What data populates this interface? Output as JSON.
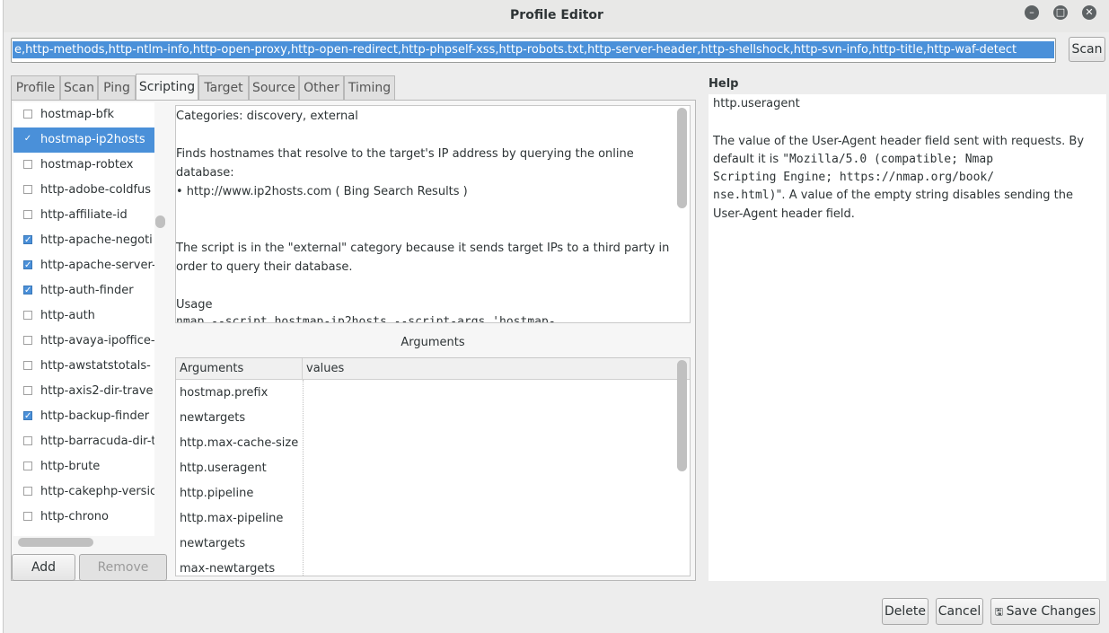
{
  "window": {
    "title": "Profile Editor"
  },
  "command": {
    "value": "e,http-methods,http-ntlm-info,http-open-proxy,http-open-redirect,http-phpself-xss,http-robots.txt,http-server-header,http-shellshock,http-svn-info,http-title,http-waf-detect"
  },
  "buttons": {
    "scan": "Scan",
    "add": "Add",
    "remove": "Remove",
    "delete": "Delete",
    "cancel": "Cancel",
    "save": "Save Changes"
  },
  "tabs": [
    "Profile",
    "Scan",
    "Ping",
    "Scripting",
    "Target",
    "Source",
    "Other",
    "Timing"
  ],
  "active_tab": "Scripting",
  "scripts": [
    {
      "label": "hostmap-bfk",
      "checked": false,
      "selected": false
    },
    {
      "label": "hostmap-ip2hosts",
      "checked": true,
      "selected": true
    },
    {
      "label": "hostmap-robtex",
      "checked": false,
      "selected": false
    },
    {
      "label": "http-adobe-coldfus",
      "checked": false,
      "selected": false
    },
    {
      "label": "http-affiliate-id",
      "checked": false,
      "selected": false
    },
    {
      "label": "http-apache-negoti",
      "checked": true,
      "selected": false
    },
    {
      "label": "http-apache-server-",
      "checked": true,
      "selected": false
    },
    {
      "label": "http-auth-finder",
      "checked": true,
      "selected": false
    },
    {
      "label": "http-auth",
      "checked": false,
      "selected": false
    },
    {
      "label": "http-avaya-ipoffice-",
      "checked": false,
      "selected": false
    },
    {
      "label": "http-awstatstotals-",
      "checked": false,
      "selected": false
    },
    {
      "label": "http-axis2-dir-trave",
      "checked": false,
      "selected": false
    },
    {
      "label": "http-backup-finder",
      "checked": true,
      "selected": false
    },
    {
      "label": "http-barracuda-dir-t",
      "checked": false,
      "selected": false
    },
    {
      "label": "http-brute",
      "checked": false,
      "selected": false
    },
    {
      "label": "http-cakephp-versic",
      "checked": false,
      "selected": false
    },
    {
      "label": "http-chrono",
      "checked": false,
      "selected": false
    }
  ],
  "description": {
    "categories": "Categories: discovery, external",
    "line1": "Finds hostnames that resolve to the target's IP address by querying the online",
    "line2": "database:",
    "bullet": "• http://www.ip2hosts.com ( Bing Search Results )",
    "line3": "The script is in the \"external\" category because it sends target IPs to a third party in",
    "line4": "order to query their database.",
    "usage": "Usage",
    "usage_cmd": "nmap --script hostmap-ip2hosts --script-args 'hostmap-"
  },
  "arguments": {
    "header": "Arguments",
    "col_args": "Arguments",
    "col_values": "values",
    "rows": [
      "hostmap.prefix",
      "newtargets",
      "http.max-cache-size",
      "http.useragent",
      "http.pipeline",
      "http.max-pipeline",
      "newtargets",
      "max-newtargets"
    ]
  },
  "help": {
    "header": "Help",
    "name": "http.useragent",
    "l1": "The value of the User-Agent header field sent with requests. By",
    "l2a": "default it is ",
    "l2b": "\"Mozilla/5.0 (compatible; Nmap",
    "l3": "Scripting Engine; https://nmap.org/book/",
    "l4a": "nse.html)",
    "l4b": "\". A value of the empty string disables sending the",
    "l5": "User-Agent header field."
  }
}
